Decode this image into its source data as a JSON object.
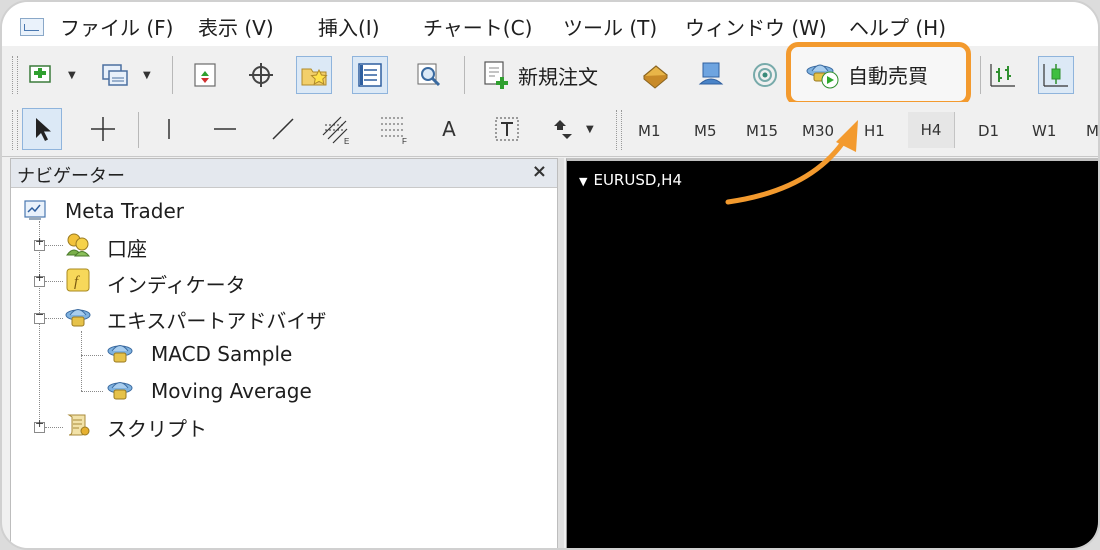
{
  "menu": [
    {
      "id": "file",
      "label": "ファイル (F)"
    },
    {
      "id": "view",
      "label": "表示 (V)"
    },
    {
      "id": "insert",
      "label": "挿入(I)"
    },
    {
      "id": "chart",
      "label": "チャート(C)"
    },
    {
      "id": "tools",
      "label": "ツール (T)"
    },
    {
      "id": "window",
      "label": "ウィンドウ (W)"
    },
    {
      "id": "help",
      "label": "ヘルプ (H)"
    }
  ],
  "toolbar": {
    "new_order_label": "新規注文",
    "auto_trading_label": "自動売買"
  },
  "drawing_tools": {
    "text_tool_glyph": "A"
  },
  "timeframes": [
    "M1",
    "M5",
    "M15",
    "M30",
    "H1",
    "H4",
    "D1",
    "W1",
    "MN"
  ],
  "active_timeframe": "H4",
  "navigator": {
    "title": "ナビゲーター",
    "close_glyph": "×",
    "root": "Meta Trader",
    "items": [
      {
        "label": "口座",
        "expander": "+"
      },
      {
        "label": "インディケータ",
        "expander": "+"
      },
      {
        "label": "エキスパートアドバイザ",
        "expander": "−"
      },
      {
        "label": "MACD Sample"
      },
      {
        "label": "Moving Average"
      },
      {
        "label": "スクリプト",
        "expander": "+"
      }
    ]
  },
  "chart_window": {
    "title": "EURUSD,H4"
  },
  "colors": {
    "highlight": "#f39a2e",
    "chart_background": "#000000"
  }
}
